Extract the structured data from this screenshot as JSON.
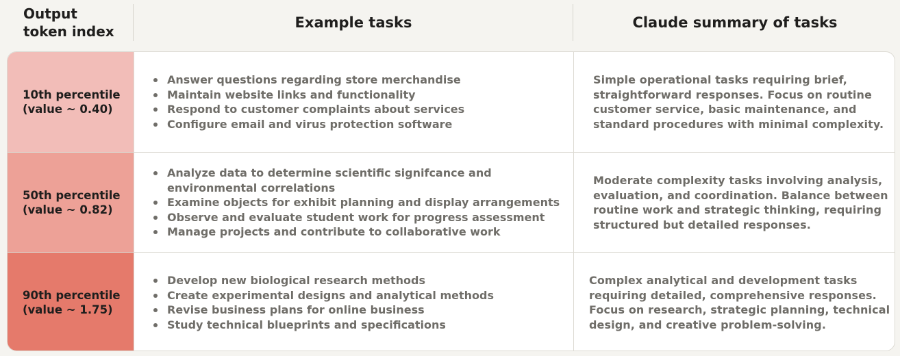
{
  "colors": {
    "row_10th": "#f2bdb8",
    "row_50th": "#eda197",
    "row_90th": "#e57a6b",
    "border": "#dcdad3",
    "text_muted": "#6f6d68"
  },
  "header": {
    "index_label": "Output\ntoken index",
    "examples_label": "Example tasks",
    "summary_label": "Claude summary of tasks"
  },
  "rows": [
    {
      "index_label": "10th percentile\n(value ~ 0.40)",
      "tasks": [
        "Answer questions regarding store merchandise",
        "Maintain website links and functionality",
        "Respond to customer complaints about services",
        "Configure email and virus protection software"
      ],
      "summary": "Simple operational tasks requiring brief, straightforward responses. Focus on routine customer service, basic maintenance, and standard procedures with minimal complexity."
    },
    {
      "index_label": "50th percentile\n(value ~ 0.82)",
      "tasks": [
        "Analyze data to determine scientific signifcance and environmental correlations",
        "Examine objects for exhibit planning and display arrangements",
        "Observe and evaluate student work for progress assessment",
        "Manage projects and contribute to collaborative work"
      ],
      "summary": "Moderate complexity tasks involving analysis, evaluation, and coordination. Balance between routine work and strategic thinking, requiring structured but detailed responses."
    },
    {
      "index_label": "90th percentile\n(value ~ 1.75)",
      "tasks": [
        "Develop new biological research methods",
        "Create experimental designs and analytical methods",
        "Revise business plans for online business",
        "Study technical blueprints and specifications"
      ],
      "summary": "Complex analytical and development tasks requiring detailed, comprehensive responses. Focus on research, strategic planning, technical design, and creative problem-solving."
    }
  ]
}
